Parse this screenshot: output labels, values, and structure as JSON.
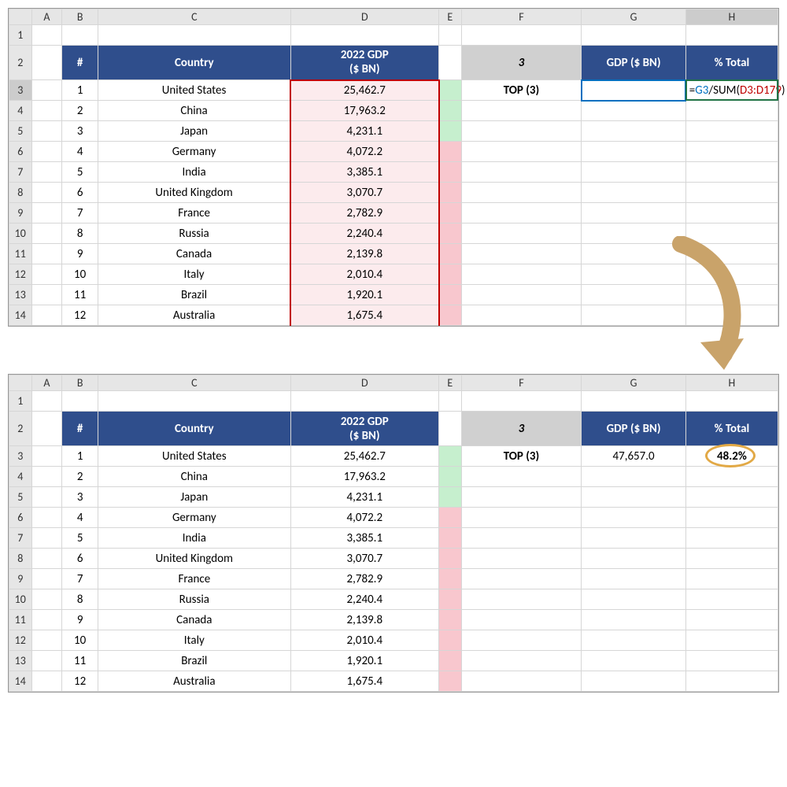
{
  "cols": [
    "",
    "A",
    "B",
    "C",
    "D",
    "E",
    "F",
    "G",
    "H"
  ],
  "rows": [
    1,
    2,
    3,
    4,
    5,
    6,
    7,
    8,
    9,
    10,
    11,
    12,
    13,
    14
  ],
  "headers": {
    "rank": "#",
    "country": "Country",
    "gdp_2022": "2022 GDP\n($ BN)",
    "n": "3",
    "gdp": "GDP ($ BN)",
    "pct": "% Total"
  },
  "left_table": [
    {
      "rank": "1",
      "country": "United States",
      "gdp": "25,462.7",
      "color": "green"
    },
    {
      "rank": "2",
      "country": "China",
      "gdp": "17,963.2",
      "color": "green"
    },
    {
      "rank": "3",
      "country": "Japan",
      "gdp": "4,231.1",
      "color": "green"
    },
    {
      "rank": "4",
      "country": "Germany",
      "gdp": "4,072.2",
      "color": "pink"
    },
    {
      "rank": "5",
      "country": "India",
      "gdp": "3,385.1",
      "color": "pink"
    },
    {
      "rank": "6",
      "country": "United Kingdom",
      "gdp": "3,070.7",
      "color": "pink"
    },
    {
      "rank": "7",
      "country": "France",
      "gdp": "2,782.9",
      "color": "pink"
    },
    {
      "rank": "8",
      "country": "Russia",
      "gdp": "2,240.4",
      "color": "pink"
    },
    {
      "rank": "9",
      "country": "Canada",
      "gdp": "2,139.8",
      "color": "pink"
    },
    {
      "rank": "10",
      "country": "Italy",
      "gdp": "2,010.4",
      "color": "pink"
    },
    {
      "rank": "11",
      "country": "Brazil",
      "gdp": "1,920.1",
      "color": "pink"
    },
    {
      "rank": "12",
      "country": "Australia",
      "gdp": "1,675.4",
      "color": "pink"
    }
  ],
  "right": {
    "top_label": "TOP (3)",
    "formula_parts": {
      "eq": "=",
      "g3": "G3",
      "slash": "/SUM(",
      "range": "D3:D179",
      "close": ")"
    },
    "result_gdp": "47,657.0",
    "result_pct": "48.2%"
  },
  "chart_data": {
    "type": "table",
    "title": "2022 GDP ($ BN) by Country",
    "categories": [
      "United States",
      "China",
      "Japan",
      "Germany",
      "India",
      "United Kingdom",
      "France",
      "Russia",
      "Canada",
      "Italy",
      "Brazil",
      "Australia"
    ],
    "values": [
      25462.7,
      17963.2,
      4231.1,
      4072.2,
      3385.1,
      3070.7,
      2782.9,
      2240.4,
      2139.8,
      2010.4,
      1920.1,
      1675.4
    ],
    "summary": {
      "top_n": 3,
      "top_sum_bn": 47657.0,
      "pct_of_total": 0.482
    }
  }
}
